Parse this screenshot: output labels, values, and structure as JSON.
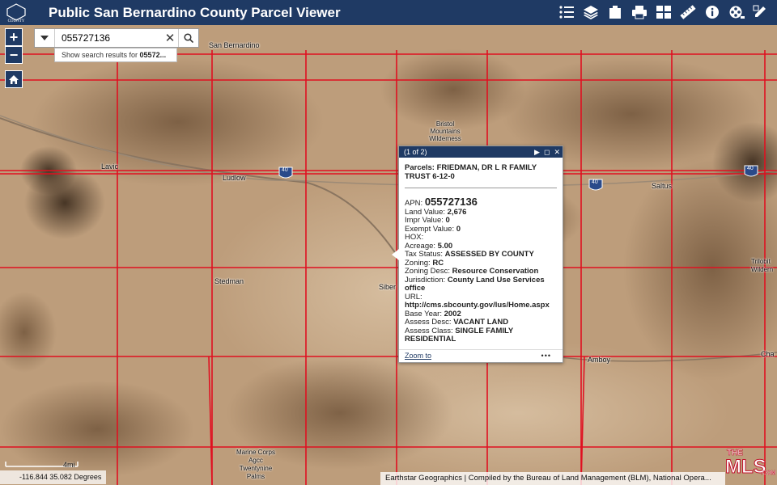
{
  "header": {
    "title": "Public San Bernardino County Parcel Viewer",
    "logo_text": "COUNTY",
    "tools": [
      "legend-icon",
      "layers-icon",
      "bookmark-icon",
      "print-icon",
      "basemap-gallery-icon",
      "measure-icon",
      "info-icon",
      "film-icon",
      "edit-icon"
    ]
  },
  "zoom": {
    "in": "+",
    "out": "−"
  },
  "search": {
    "value": "055727136",
    "suggestion_prefix": "Show search results for ",
    "suggestion_term": "05572..."
  },
  "popup": {
    "counter": "(1 of 2)",
    "title": "Parcels: FRIEDMAN, DR L R FAMILY TRUST 6-12-0",
    "apn_label": "APN:",
    "apn": "055727136",
    "fields": [
      {
        "label": "Land Value:",
        "value": "2,676"
      },
      {
        "label": "Impr Value:",
        "value": "0"
      },
      {
        "label": "Exempt Value:",
        "value": "0"
      },
      {
        "label": "HOX:",
        "value": ""
      },
      {
        "label": "Acreage:",
        "value": "5.00"
      },
      {
        "label": "Tax Status:",
        "value": "ASSESSED BY COUNTY"
      },
      {
        "label": "Zoning:",
        "value": "RC"
      },
      {
        "label": "Zoning Desc:",
        "value": "Resource Conservation"
      },
      {
        "label": "Jurisdiction:",
        "value": "County Land Use Services office"
      },
      {
        "label": "URL:",
        "value": "http://cms.sbcounty.gov/lus/Home.aspx"
      },
      {
        "label": "Base Year:",
        "value": "2002"
      },
      {
        "label": "Assess Desc:",
        "value": "VACANT LAND"
      },
      {
        "label": "Assess Class:",
        "value": "SINGLE FAMILY RESIDENTIAL"
      }
    ],
    "zoom_to": "Zoom to",
    "more": "•••"
  },
  "map_labels": {
    "san_bernardino": "San Bernardino",
    "lavic": "Lavic",
    "ludlow": "Ludlow",
    "bristol": "Bristol Mountains Wilderness",
    "saltus": "Saltus",
    "trilobite": "Trilobit Wildern",
    "stedman": "Stedman",
    "siber": "Siber",
    "amboy": "Amboy",
    "chamb": "Cha",
    "marine": "Marine Corps Agcc Twentynine Palms",
    "i40": "40"
  },
  "scale": {
    "label": "4mi"
  },
  "coords": {
    "text": "-116.844 35.082 Degrees"
  },
  "attribution": "Earthstar Geographics | Compiled by the Bureau of Land Management (BLM), National Opera...",
  "watermark": {
    "text": "THE MLS .COM"
  },
  "colors": {
    "header": "#1f3a64",
    "parcel_lines": "#e01020",
    "terrain": "#b99a78"
  }
}
